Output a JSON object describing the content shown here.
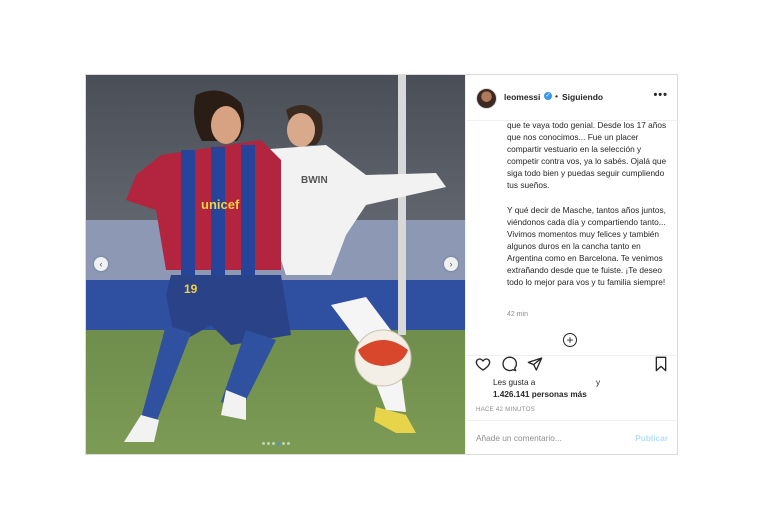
{
  "post": {
    "username": "leomessi",
    "verified_mark": "✓",
    "separator": "•",
    "follow_label": "Siguiendo",
    "more_label": "•••",
    "caption_p1": "que te vaya todo genial. Desde los 17 años que nos conocimos... Fue un placer compartir vestuario en la selección y competir contra vos, ya lo sabés. Ojalá que siga todo bien y puedas seguir cumpliendo tus sueños.",
    "caption_p2": "Y qué decir de Masche, tantos años juntos, viéndonos cada día y compartiendo tanto... Vivimos momentos muy felices y también algunos duros en la cancha tanto en Argentina como en Barcelona. Te venimos extrañando desde que te fuiste. ¡Te deseo todo lo mejor para vos y tu familia siempre!",
    "time_short": "42 min",
    "load_more_symbol": "+",
    "likes_prefix": "Les gusta a",
    "likes_tail": "y",
    "likes_count": "1.426.141",
    "likes_suffix": "personas más",
    "time_ago": "HACE 42 MINUTOS",
    "comment_placeholder": "Añade un comentario...",
    "publish_label": "Publicar"
  },
  "media": {
    "shirt_text": "unicef",
    "shirt_number": "19",
    "sponsor_text": "BWIN",
    "nav_prev": "‹",
    "nav_next": "›",
    "carousel_count": 6,
    "carousel_active": 3
  },
  "icons": [
    "heart-icon",
    "comment-icon",
    "share-icon",
    "bookmark-icon",
    "add-circle-icon",
    "verified-icon",
    "more-icon"
  ],
  "colors": {
    "accent": "#3897f0",
    "publish_disabled": "#b2dffc",
    "muted": "#8e8e8e"
  }
}
